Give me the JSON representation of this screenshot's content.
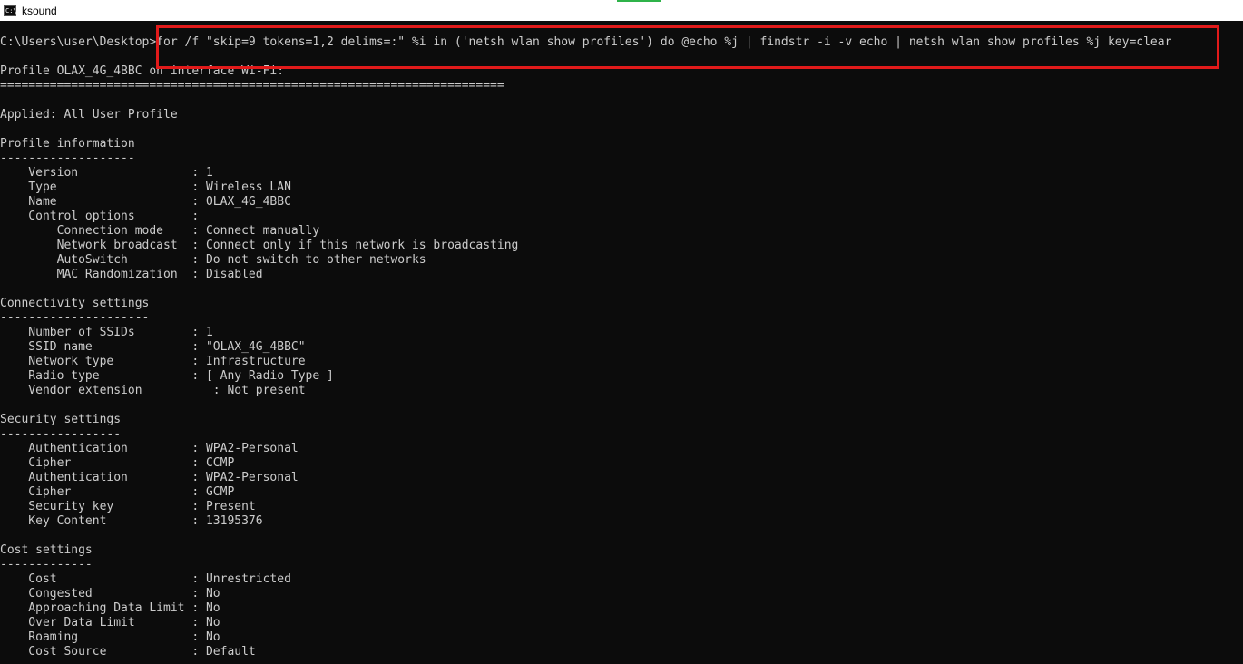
{
  "window": {
    "title": "ksound",
    "icon": "console-icon",
    "icon_glyph": "C:\\"
  },
  "console": {
    "lines": [
      "C:\\Users\\user\\Desktop>for /f \"skip=9 tokens=1,2 delims=:\" %i in ('netsh wlan show profiles') do @echo %j | findstr -i -v echo | netsh wlan show profiles %j key=clear",
      "",
      "Profile OLAX_4G_4BBC on interface Wi-Fi:",
      "=======================================================================",
      "",
      "Applied: All User Profile",
      "",
      "Profile information",
      "-------------------",
      "    Version                : 1",
      "    Type                   : Wireless LAN",
      "    Name                   : OLAX_4G_4BBC",
      "    Control options        :",
      "        Connection mode    : Connect manually",
      "        Network broadcast  : Connect only if this network is broadcasting",
      "        AutoSwitch         : Do not switch to other networks",
      "        MAC Randomization  : Disabled",
      "",
      "Connectivity settings",
      "---------------------",
      "    Number of SSIDs        : 1",
      "    SSID name              : \"OLAX_4G_4BBC\"",
      "    Network type           : Infrastructure",
      "    Radio type             : [ Any Radio Type ]",
      "    Vendor extension          : Not present",
      "",
      "Security settings",
      "-----------------",
      "    Authentication         : WPA2-Personal",
      "    Cipher                 : CCMP",
      "    Authentication         : WPA2-Personal",
      "    Cipher                 : GCMP",
      "    Security key           : Present",
      "    Key Content            : 13195376",
      "",
      "Cost settings",
      "-------------",
      "    Cost                   : Unrestricted",
      "    Congested              : No",
      "    Approaching Data Limit : No",
      "    Over Data Limit        : No",
      "    Roaming                : No",
      "    Cost Source            : Default"
    ]
  },
  "colors": {
    "console_bg": "#0c0c0c",
    "console_fg": "#cccccc",
    "highlight": "#e21a1a"
  }
}
